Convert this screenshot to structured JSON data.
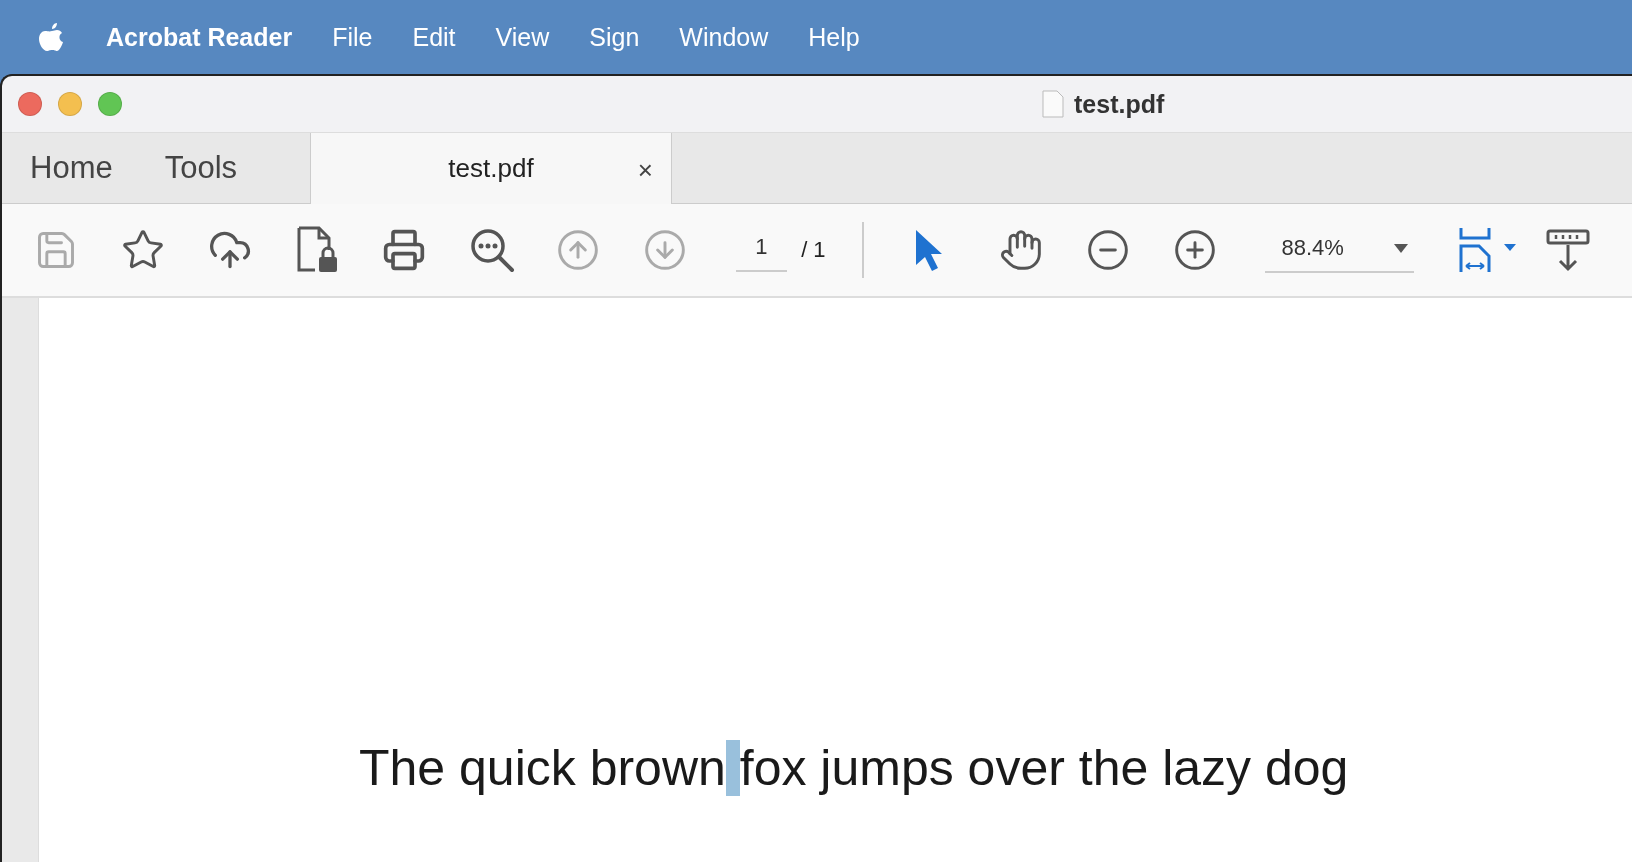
{
  "menu_bar": {
    "app": "Acrobat Reader",
    "items": [
      "File",
      "Edit",
      "View",
      "Sign",
      "Window",
      "Help"
    ]
  },
  "window": {
    "title": "test.pdf"
  },
  "tabs": [
    {
      "label": "Home",
      "selected": false,
      "kind": "nav"
    },
    {
      "label": "Tools",
      "selected": false,
      "kind": "nav"
    },
    {
      "label": "test.pdf",
      "selected": true,
      "kind": "document",
      "close": "×"
    }
  ],
  "toolbar": [
    {
      "kind": "save",
      "disabled": true
    },
    {
      "kind": "bookmark",
      "disabled": false
    },
    {
      "kind": "upload",
      "disabled": false
    },
    {
      "kind": "protect",
      "disabled": false
    },
    {
      "kind": "print",
      "disabled": false
    },
    {
      "kind": "find",
      "disabled": false
    },
    {
      "kind": "prev",
      "disabled": true
    },
    {
      "kind": "next",
      "disabled": true
    },
    {
      "kind": "page",
      "value": "1",
      "total": "/ 1"
    },
    {
      "kind": "divider"
    },
    {
      "kind": "pointer",
      "selected": true
    },
    {
      "kind": "hand",
      "selected": false
    },
    {
      "kind": "zoom_out",
      "disabled": false
    },
    {
      "kind": "zoom_in",
      "disabled": false
    },
    {
      "kind": "zoom",
      "value": "88.4%"
    },
    {
      "kind": "fit",
      "disabled": false
    },
    {
      "kind": "ruler",
      "disabled": false
    }
  ],
  "document": {
    "text": [
      {
        "text": "The quick brown"
      },
      {
        "text": "fox jumps over the lazy dog",
        "selected_space_before": true
      }
    ]
  }
}
